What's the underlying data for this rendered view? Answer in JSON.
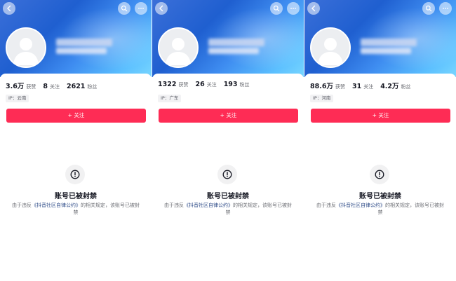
{
  "labels": {
    "likes": "获赞",
    "following": "关注",
    "followers": "粉丝",
    "ip_prefix": "IP：",
    "follow_button": "+ 关注",
    "ban_title": "账号已被封禁",
    "ban_desc_pre": "由于违反",
    "ban_desc_link": "《抖音社区自律公约》",
    "ban_desc_post": "的相关规定，该账号已被封禁"
  },
  "panels": [
    {
      "likes": "3.6万",
      "following": "8",
      "followers": "2621",
      "ip": "云南"
    },
    {
      "likes": "1322",
      "following": "26",
      "followers": "193",
      "ip": "广东"
    },
    {
      "likes": "88.6万",
      "following": "31",
      "followers": "4.2万",
      "ip": "河南"
    }
  ],
  "colors": {
    "accent": "#fe2c55",
    "link": "#2c4a87",
    "banner_start": "#1f5fd0",
    "banner_end": "#78d6ff"
  },
  "icons": [
    "back-arrow-icon",
    "search-icon",
    "more-icon",
    "warning-icon",
    "avatar-placeholder-icon"
  ]
}
